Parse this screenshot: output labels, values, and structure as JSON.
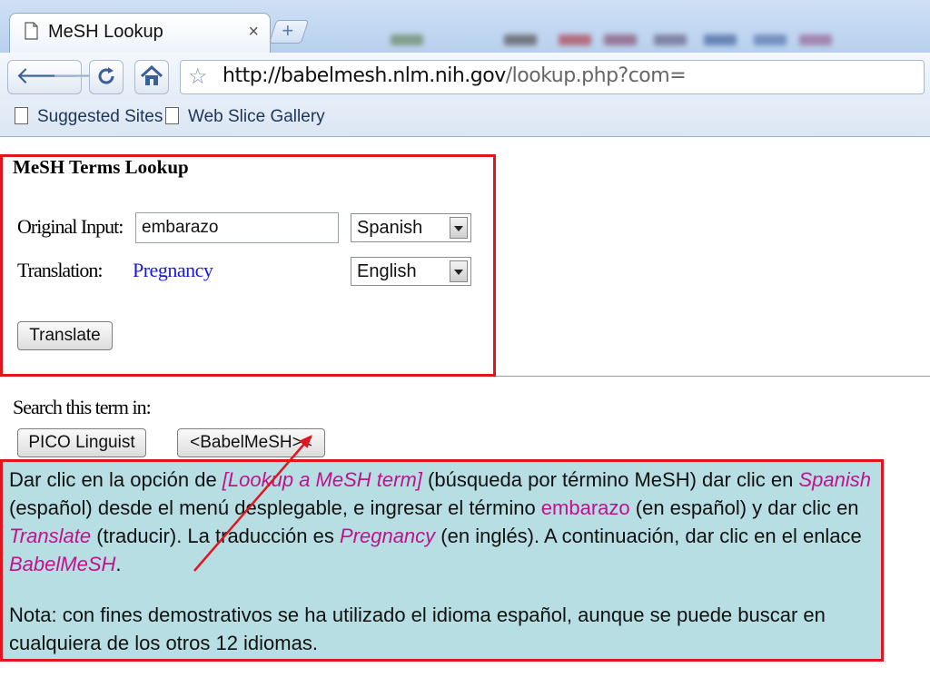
{
  "browser": {
    "tab_title": "MeSH Lookup",
    "tab_close": "×",
    "new_tab": "+",
    "url_host": "http://babelmesh.nlm.nih.gov",
    "url_path": "/lookup.php?com=",
    "bookmarks": [
      "Suggested Sites",
      "Web Slice Gallery"
    ]
  },
  "lookup": {
    "title": "MeSH Terms Lookup",
    "original_input_label": "Original Input:",
    "original_input_value": "embarazo",
    "source_language": "Spanish",
    "translation_label": "Translation:",
    "translation_value": "Pregnancy",
    "target_language": "English",
    "translate_button": "Translate"
  },
  "search": {
    "label": "Search this term in:",
    "pico_button": "PICO Linguist",
    "babelmesh_button": "<BabelMeSH><"
  },
  "note": {
    "p1": [
      {
        "t": "Dar clic en la opción de "
      },
      {
        "t": "[Lookup a MeSH term]",
        "hl": true
      },
      {
        "t": "  (búsqueda por término MeSH) dar clic en "
      },
      {
        "t": "Spanish",
        "hl": true
      },
      {
        "t": " (español) desde el menú desplegable, e ingresar el término "
      },
      {
        "t": "embarazo",
        "hl": true,
        "noit": true
      },
      {
        "t": " (en español) y dar clic en "
      },
      {
        "t": "Translate",
        "hl": true
      },
      {
        "t": " (traducir). La traducción es  "
      },
      {
        "t": "Pregnancy",
        "hl": true
      },
      {
        "t": "  (en inglés).  A continuación, dar clic en el enlace  "
      },
      {
        "t": "BabelMeSH",
        "hl": true
      },
      {
        "t": "."
      }
    ],
    "p2": "Nota: con fines demostrativos se ha utilizado el idioma español, aunque se puede buscar en cualquiera de los otros 12 idiomas."
  },
  "colors": {
    "highlight": "#c2118c",
    "frame": "#e2141f",
    "note_bg": "#b7dee3",
    "translation": "#1a1adb"
  }
}
